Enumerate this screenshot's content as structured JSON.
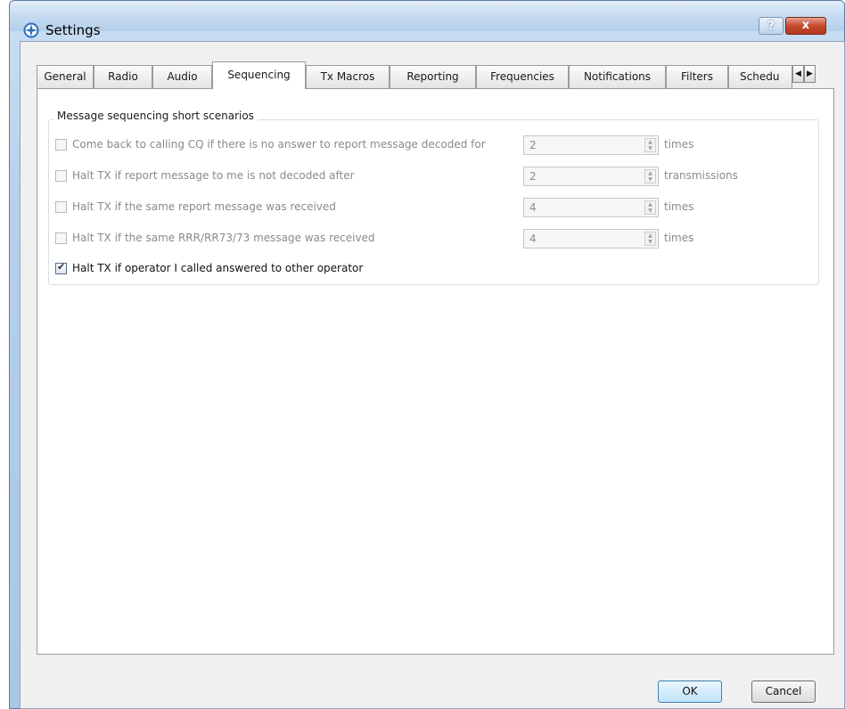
{
  "window": {
    "title": "Settings",
    "help_label": "?",
    "close_label": "x"
  },
  "tabs": [
    {
      "label": "General"
    },
    {
      "label": "Radio"
    },
    {
      "label": "Audio"
    },
    {
      "label": "Sequencing",
      "active": true
    },
    {
      "label": "Tx Macros"
    },
    {
      "label": "Reporting"
    },
    {
      "label": "Frequencies"
    },
    {
      "label": "Notifications"
    },
    {
      "label": "Filters"
    },
    {
      "label": "Schedu"
    }
  ],
  "tab_scroll": {
    "left_icon": "arrow-left-icon",
    "right_icon": "arrow-right-icon",
    "left_glyph": "◀",
    "right_glyph": "▶"
  },
  "group": {
    "title": "Message sequencing short scenarios",
    "rows": [
      {
        "label": "Come back to calling CQ if there is no answer to report message decoded for",
        "checked": false,
        "enabled": false,
        "value": "2",
        "unit": "times"
      },
      {
        "label": "Halt TX if report message to me is not decoded after",
        "checked": false,
        "enabled": false,
        "value": "2",
        "unit": "transmissions"
      },
      {
        "label": "Halt TX if the same report message was received",
        "checked": false,
        "enabled": false,
        "value": "4",
        "unit": "times"
      },
      {
        "label": "Halt TX if the same RRR/RR73/73 message was received",
        "checked": false,
        "enabled": false,
        "value": "4",
        "unit": "times"
      },
      {
        "label": "Halt TX if operator I called answered to other operator",
        "checked": true,
        "enabled": true
      }
    ]
  },
  "buttons": {
    "ok": "OK",
    "cancel": "Cancel"
  },
  "colors": {
    "accent_default_button": "#3c7fb1",
    "close_button": "#c44a2e",
    "disabled_text": "#8a8a8a"
  }
}
